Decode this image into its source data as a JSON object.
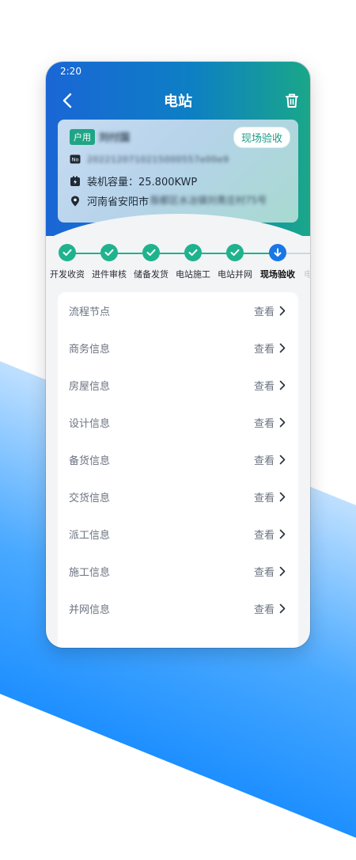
{
  "status_bar": {
    "time": "2:20"
  },
  "nav": {
    "title": "电站"
  },
  "station": {
    "type_tag": "户用",
    "owner_name": "刘付国",
    "stage_badge": "现场验收",
    "serial_number": "2022120710215000557e00e9",
    "capacity_text": "装机容量：25.800KWP",
    "address_prefix": "河南省安阳市",
    "address_detail": "殷都区水冶镇刘青庄村75号"
  },
  "steps": [
    {
      "label": "开发收资",
      "state": "done"
    },
    {
      "label": "进件审核",
      "state": "done"
    },
    {
      "label": "储备发货",
      "state": "done"
    },
    {
      "label": "电站施工",
      "state": "done"
    },
    {
      "label": "电站并网",
      "state": "done"
    },
    {
      "label": "现场验收",
      "state": "current"
    },
    {
      "label": "电",
      "state": "pending"
    }
  ],
  "list": {
    "action_label": "查看",
    "items": [
      {
        "label": "流程节点"
      },
      {
        "label": "商务信息"
      },
      {
        "label": "房屋信息"
      },
      {
        "label": "设计信息"
      },
      {
        "label": "备货信息"
      },
      {
        "label": "交货信息"
      },
      {
        "label": "派工信息"
      },
      {
        "label": "施工信息"
      },
      {
        "label": "并网信息"
      }
    ]
  },
  "colors": {
    "accent_green": "#1fb38d",
    "current_blue": "#1877e5",
    "header_start": "#1a66d6",
    "header_end": "#1aa789"
  },
  "icons": {
    "back": "chevron-left-icon",
    "delete": "trash-icon",
    "serial": "number-icon",
    "capacity": "battery-icon",
    "location": "location-pin-icon",
    "done": "check-icon",
    "current": "arrow-down-icon",
    "row": "chevron-right-icon"
  }
}
